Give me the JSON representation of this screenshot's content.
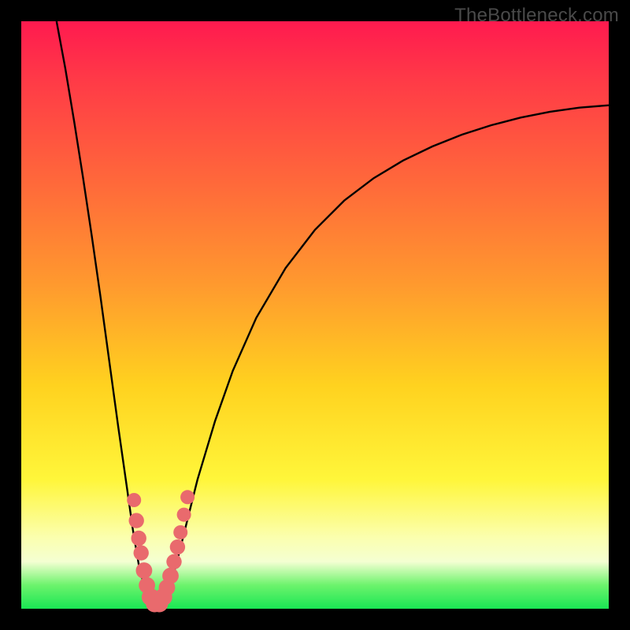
{
  "watermark": "TheBottleneck.com",
  "colors": {
    "frame": "#000000",
    "gradient_top": "#ff1a4f",
    "gradient_bottom": "#19e654",
    "curve_stroke": "#000000",
    "dot_fill": "#e96a6d"
  },
  "chart_data": {
    "type": "line",
    "title": "",
    "xlabel": "",
    "ylabel": "",
    "xlim": [
      0,
      100
    ],
    "ylim": [
      0,
      100
    ],
    "curve": [
      {
        "x": 6.0,
        "y": 100.0
      },
      {
        "x": 7.5,
        "y": 92.0
      },
      {
        "x": 9.0,
        "y": 83.0
      },
      {
        "x": 10.5,
        "y": 73.5
      },
      {
        "x": 12.0,
        "y": 63.5
      },
      {
        "x": 13.5,
        "y": 53.0
      },
      {
        "x": 15.0,
        "y": 42.0
      },
      {
        "x": 16.5,
        "y": 31.0
      },
      {
        "x": 18.0,
        "y": 20.5
      },
      {
        "x": 19.0,
        "y": 13.5
      },
      {
        "x": 20.0,
        "y": 7.5
      },
      {
        "x": 21.0,
        "y": 3.5
      },
      {
        "x": 22.0,
        "y": 1.0
      },
      {
        "x": 23.0,
        "y": 0.4
      },
      {
        "x": 24.0,
        "y": 1.0
      },
      {
        "x": 25.0,
        "y": 3.0
      },
      {
        "x": 26.0,
        "y": 6.2
      },
      {
        "x": 27.0,
        "y": 10.0
      },
      {
        "x": 28.5,
        "y": 16.0
      },
      {
        "x": 30.0,
        "y": 22.0
      },
      {
        "x": 33.0,
        "y": 32.0
      },
      {
        "x": 36.0,
        "y": 40.5
      },
      {
        "x": 40.0,
        "y": 49.5
      },
      {
        "x": 45.0,
        "y": 58.0
      },
      {
        "x": 50.0,
        "y": 64.5
      },
      {
        "x": 55.0,
        "y": 69.5
      },
      {
        "x": 60.0,
        "y": 73.3
      },
      {
        "x": 65.0,
        "y": 76.3
      },
      {
        "x": 70.0,
        "y": 78.7
      },
      {
        "x": 75.0,
        "y": 80.7
      },
      {
        "x": 80.0,
        "y": 82.3
      },
      {
        "x": 85.0,
        "y": 83.6
      },
      {
        "x": 90.0,
        "y": 84.6
      },
      {
        "x": 95.0,
        "y": 85.3
      },
      {
        "x": 100.0,
        "y": 85.7
      }
    ],
    "dots": [
      {
        "x": 19.2,
        "y": 18.5,
        "r": 1.2
      },
      {
        "x": 19.6,
        "y": 15.0,
        "r": 1.3
      },
      {
        "x": 20.0,
        "y": 12.0,
        "r": 1.3
      },
      {
        "x": 20.4,
        "y": 9.5,
        "r": 1.3
      },
      {
        "x": 20.9,
        "y": 6.5,
        "r": 1.4
      },
      {
        "x": 21.4,
        "y": 4.0,
        "r": 1.4
      },
      {
        "x": 22.0,
        "y": 2.0,
        "r": 1.5
      },
      {
        "x": 22.7,
        "y": 0.9,
        "r": 1.5
      },
      {
        "x": 23.5,
        "y": 0.9,
        "r": 1.5
      },
      {
        "x": 24.2,
        "y": 2.0,
        "r": 1.5
      },
      {
        "x": 24.8,
        "y": 3.6,
        "r": 1.4
      },
      {
        "x": 25.4,
        "y": 5.6,
        "r": 1.4
      },
      {
        "x": 26.0,
        "y": 8.0,
        "r": 1.3
      },
      {
        "x": 26.6,
        "y": 10.5,
        "r": 1.3
      },
      {
        "x": 27.1,
        "y": 13.0,
        "r": 1.2
      },
      {
        "x": 27.7,
        "y": 16.0,
        "r": 1.2
      },
      {
        "x": 28.3,
        "y": 19.0,
        "r": 1.2
      }
    ]
  }
}
